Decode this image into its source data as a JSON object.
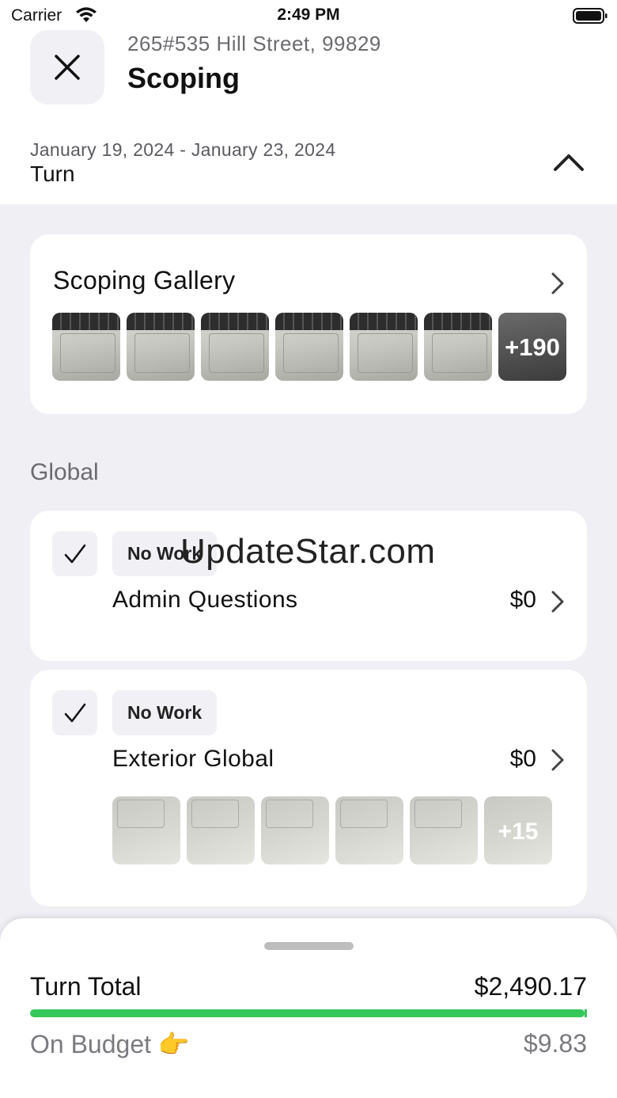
{
  "status_bar": {
    "carrier": "Carrier",
    "time": "2:49 PM"
  },
  "header": {
    "address": "265#535 Hill Street, 99829",
    "title": "Scoping",
    "date_range": "January 19, 2024 - January 23, 2024",
    "job_type": "Turn"
  },
  "gallery": {
    "title": "Scoping Gallery",
    "more_count": "+190"
  },
  "section": {
    "label": "Global"
  },
  "items": [
    {
      "badge": "No Work",
      "title": "Admin Questions",
      "price": "$0"
    },
    {
      "badge": "No Work",
      "title": "Exterior Global",
      "price": "$0",
      "more_count": "+15"
    }
  ],
  "watermark": "UpdateStar.com",
  "summary": {
    "total_label": "Turn Total",
    "total_value": "$2,490.17",
    "budget_label": "On Budget 👉",
    "budget_value": "$9.83",
    "budget_progress": 0.996
  },
  "colors": {
    "progress": "#34c759",
    "background": "#efeff4"
  }
}
